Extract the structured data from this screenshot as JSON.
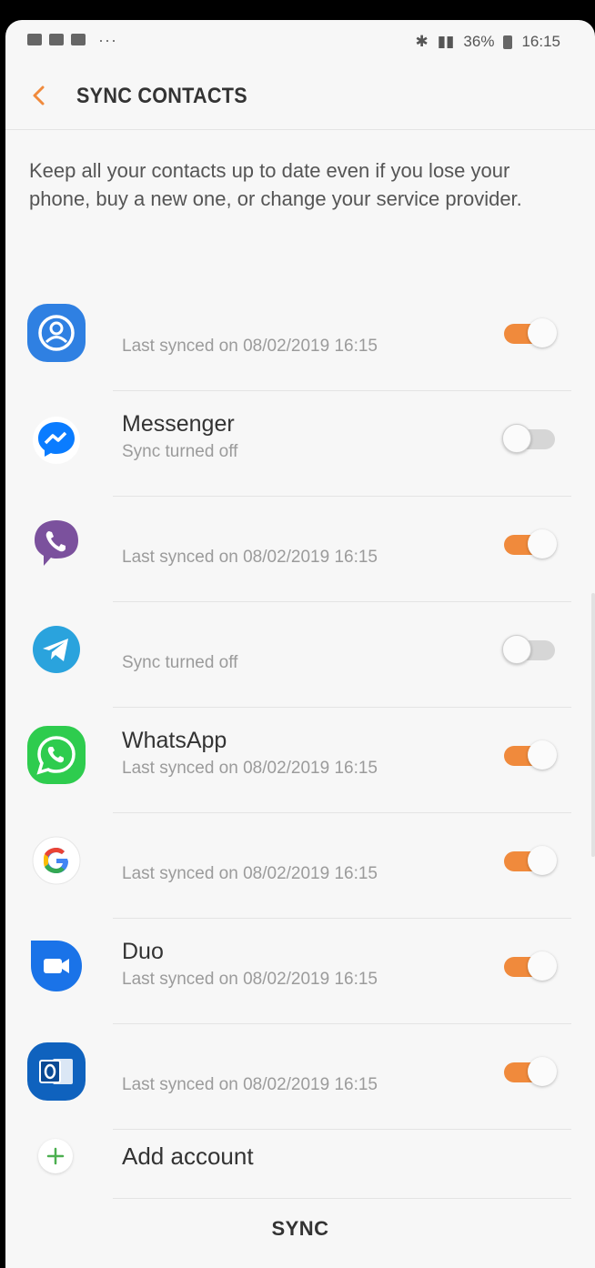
{
  "status_bar": {
    "dots": "···",
    "right_text": "36%",
    "time": "16:15"
  },
  "header": {
    "title": "SYNC CONTACTS"
  },
  "description": "Keep all your contacts up to date even if you lose your phone, buy a new one, or change your service provider.",
  "accounts": [
    {
      "label": "",
      "status": "Last synced on 08/02/2019  16:15",
      "enabled": true,
      "icon": "samsung-account-icon"
    },
    {
      "label": "Messenger",
      "status": "Sync turned off",
      "enabled": false,
      "icon": "messenger-icon"
    },
    {
      "label": "",
      "status": "Last synced on 08/02/2019  16:15",
      "enabled": true,
      "icon": "viber-icon"
    },
    {
      "label": "",
      "status": "Sync turned off",
      "enabled": false,
      "icon": "telegram-icon"
    },
    {
      "label": "WhatsApp",
      "status": "Last synced on 08/02/2019  16:15",
      "enabled": true,
      "icon": "whatsapp-icon"
    },
    {
      "label": "",
      "status": "Last synced on 08/02/2019  16:15",
      "enabled": true,
      "icon": "google-icon"
    },
    {
      "label": "Duo",
      "status": "Last synced on 08/02/2019  16:15",
      "enabled": true,
      "icon": "duo-icon"
    },
    {
      "label": "",
      "status": "Last synced on 08/02/2019  16:15",
      "enabled": true,
      "icon": "outlook-icon"
    }
  ],
  "add_account": {
    "label": "Add account"
  },
  "footer": {
    "sync_label": "SYNC"
  },
  "colors": {
    "accent": "#f08a3c",
    "toggle_off": "#d6d6d6"
  }
}
